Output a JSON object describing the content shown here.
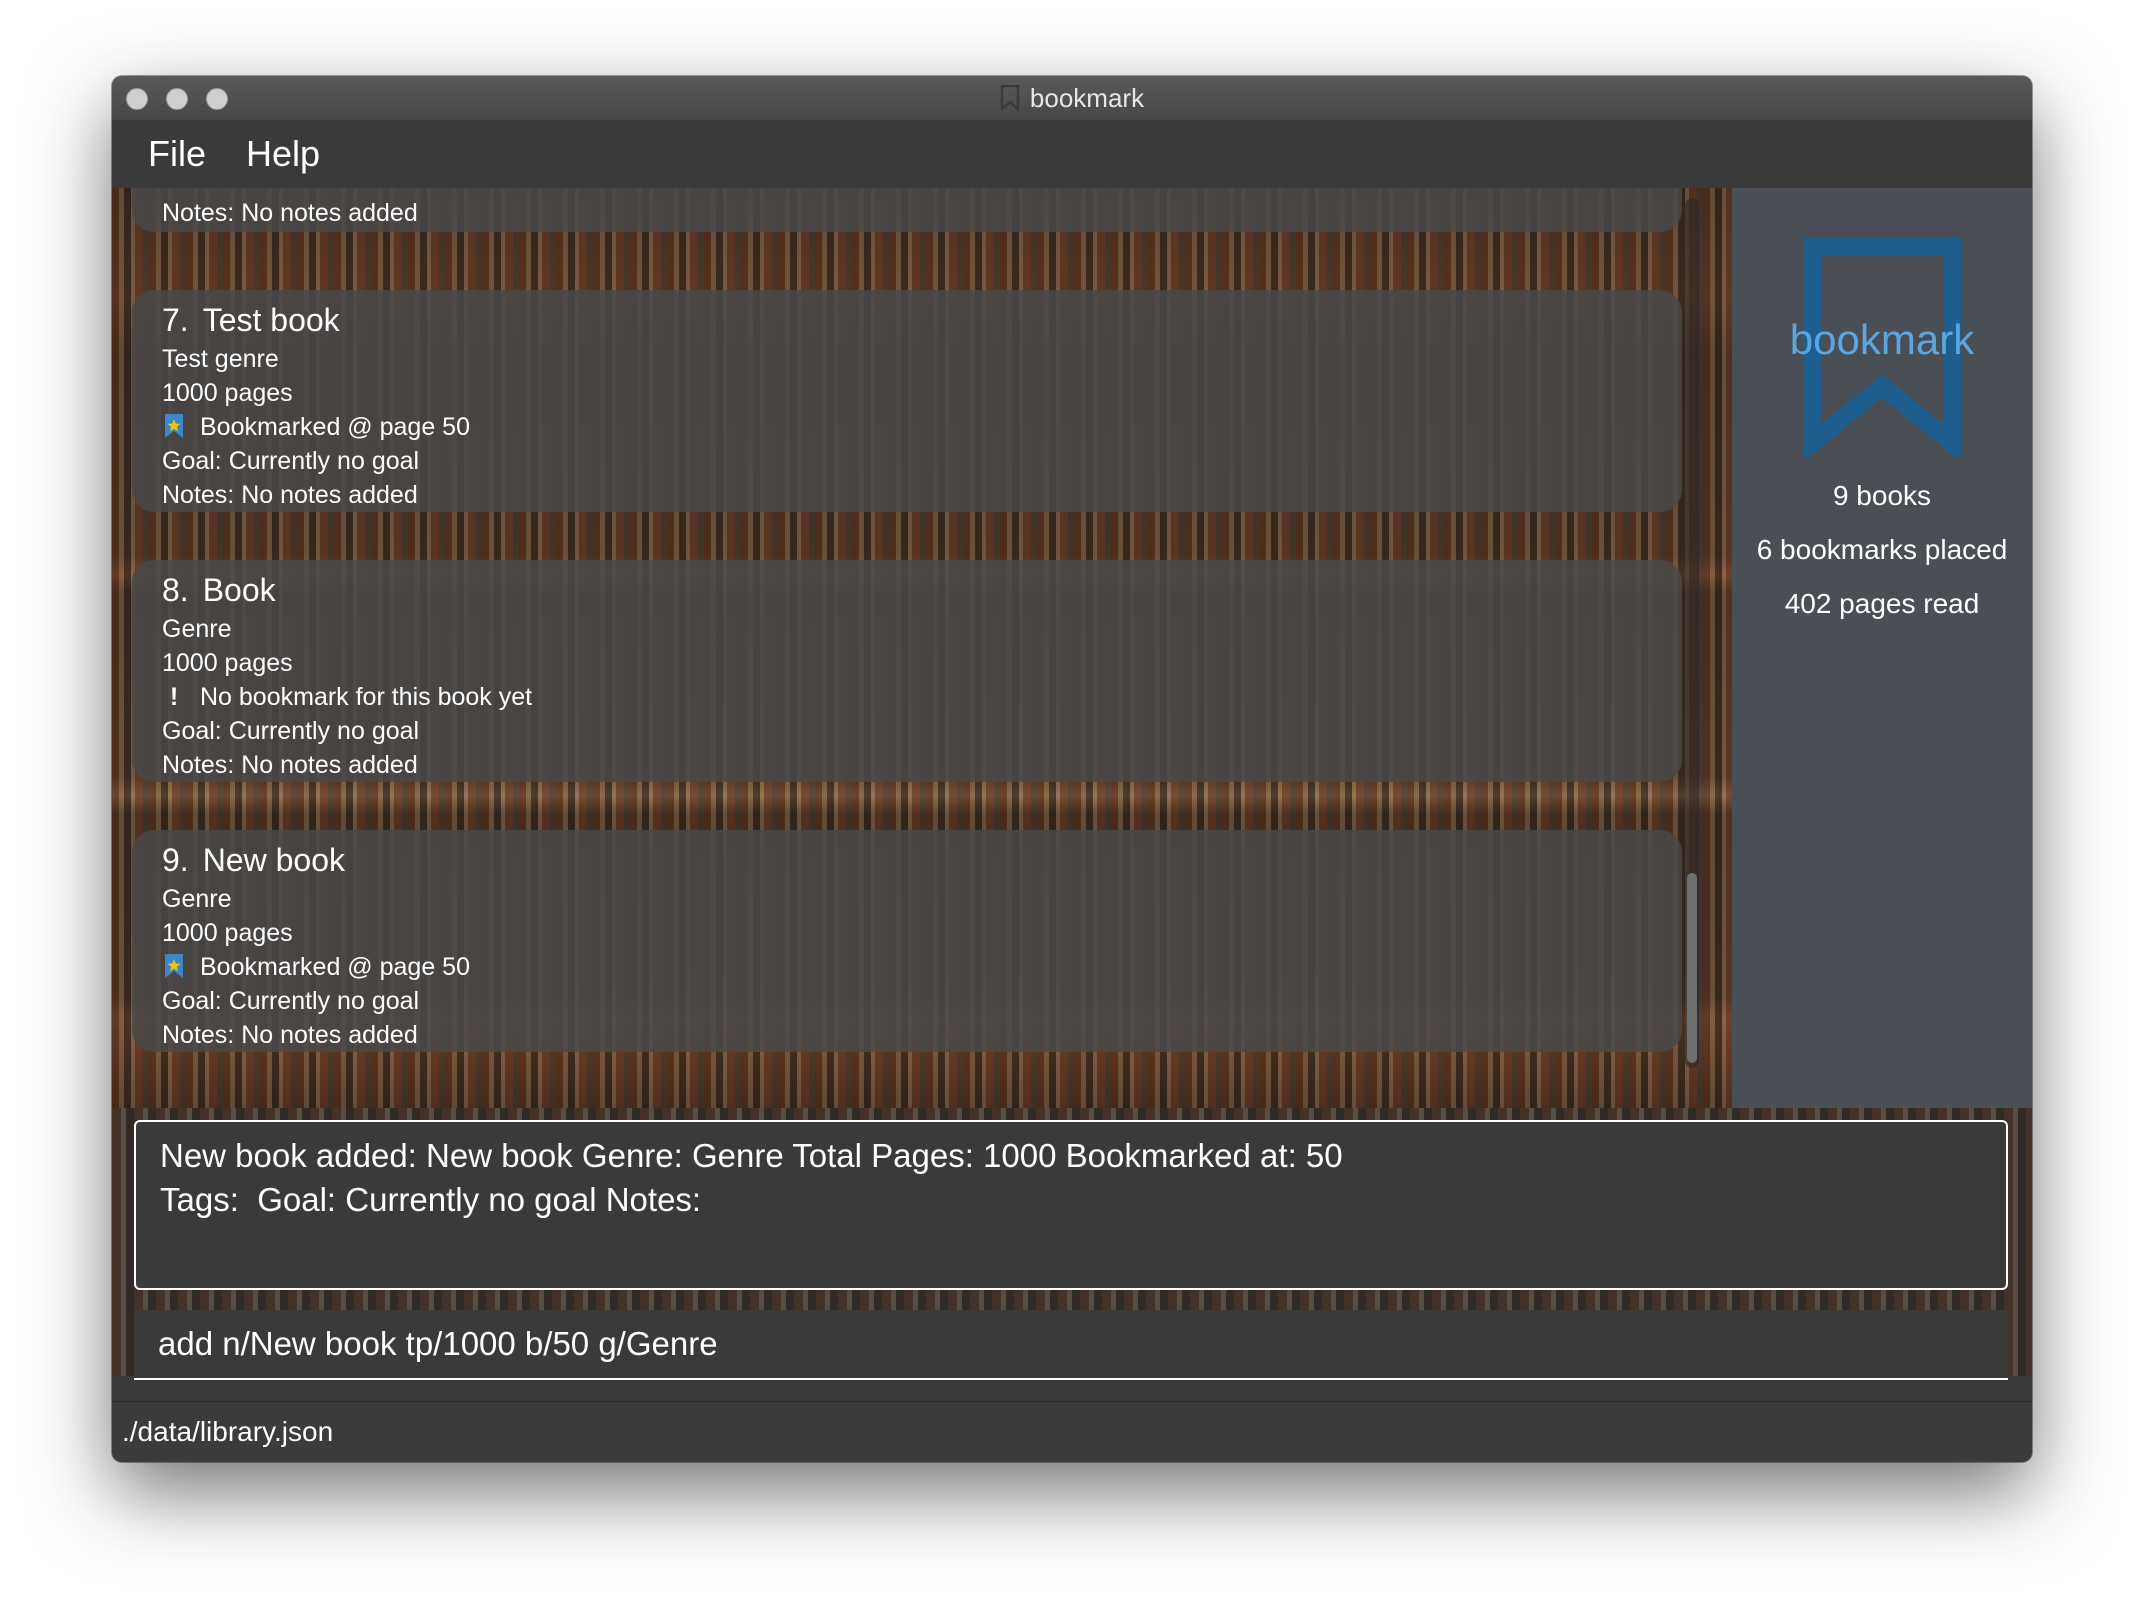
{
  "window": {
    "title": "bookmark"
  },
  "menu": {
    "file": "File",
    "help": "Help"
  },
  "partial_card": {
    "notes": "Notes: No notes added"
  },
  "books": [
    {
      "index": "7.",
      "title": "Test book",
      "genre": "Test genre",
      "pages": "1000 pages",
      "bookmark_icon": "bookmark-star-icon",
      "bookmark": "Bookmarked @ page 50",
      "goal": "Goal: Currently no goal",
      "notes": "Notes: No notes added"
    },
    {
      "index": "8.",
      "title": "Book",
      "genre": "Genre",
      "pages": "1000 pages",
      "bookmark_icon": "exclamation-icon",
      "bookmark": "No bookmark for this book yet",
      "goal": "Goal: Currently no goal",
      "notes": "Notes: No notes added"
    },
    {
      "index": "9.",
      "title": "New book",
      "genre": "Genre",
      "pages": "1000 pages",
      "bookmark_icon": "bookmark-star-icon",
      "bookmark": "Bookmarked @ page 50",
      "goal": "Goal: Currently no goal",
      "notes": "Notes: No notes added"
    }
  ],
  "summary": {
    "logo_text": "bookmark",
    "books": "9 books",
    "bookmarks": "6 bookmarks placed",
    "pages_read": "402 pages read"
  },
  "result": {
    "line1": "New book added: New book Genre: Genre Total Pages: 1000 Bookmarked at: 50",
    "line2": "Tags:  Goal: Currently no goal Notes:"
  },
  "command": {
    "value": "add n/New book tp/1000 b/50 g/Genre"
  },
  "status": {
    "path": "./data/library.json"
  },
  "colors": {
    "logo_blue": "#1f5f8f",
    "logo_text": "#5aa6e0",
    "panel_bg": "#4a4f55",
    "card_bg": "#484848"
  }
}
